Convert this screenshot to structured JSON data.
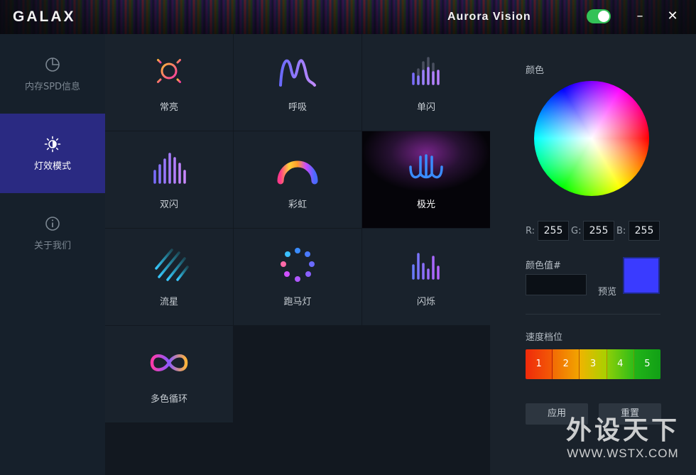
{
  "header": {
    "logo": "GALAX",
    "brand": "Aurora Vision",
    "toggle_on": true,
    "minimize_icon": "minimize-icon",
    "close_icon": "close-icon",
    "toggle_color": "#33c257"
  },
  "sidebar": {
    "items": [
      {
        "label": "内存SPD信息",
        "icon": "pie-chart-icon",
        "active": false
      },
      {
        "label": "灯效模式",
        "icon": "brightness-icon",
        "active": true
      },
      {
        "label": "关于我们",
        "icon": "info-icon",
        "active": false
      }
    ],
    "active_color": "#2a2a82"
  },
  "modes": [
    {
      "label": "常亮",
      "icon": "sun-icon"
    },
    {
      "label": "呼吸",
      "icon": "wave-icon"
    },
    {
      "label": "单闪",
      "icon": "bars-icon"
    },
    {
      "label": "双闪",
      "icon": "double-bars-icon"
    },
    {
      "label": "彩虹",
      "icon": "rainbow-icon"
    },
    {
      "label": "极光",
      "icon": "aurora-icon",
      "selected": true
    },
    {
      "label": "流星",
      "icon": "meteor-icon"
    },
    {
      "label": "跑马灯",
      "icon": "dots-ring-icon"
    },
    {
      "label": "闪烁",
      "icon": "flicker-bars-icon"
    },
    {
      "label": "多色循环",
      "icon": "infinity-icon"
    }
  ],
  "panel": {
    "color_label": "颜色",
    "r_label": "R:",
    "g_label": "G:",
    "b_label": "B:",
    "r": "255",
    "g": "255",
    "b": "255",
    "hex_label": "颜色值#",
    "hex_value": "",
    "preview_label": "预览",
    "preview_color": "#3a3bff",
    "speed_label": "速度档位",
    "speed_levels": [
      "1",
      "2",
      "3",
      "4",
      "5"
    ],
    "speed_colors": [
      "#f0300a",
      "#f2a000",
      "#b8d000",
      "#3cc21a",
      "#13a516"
    ],
    "apply_label": "应用",
    "reset_label": "重置"
  },
  "watermark": {
    "line1": "外设天下",
    "line2": "WWW.WSTX.COM"
  }
}
